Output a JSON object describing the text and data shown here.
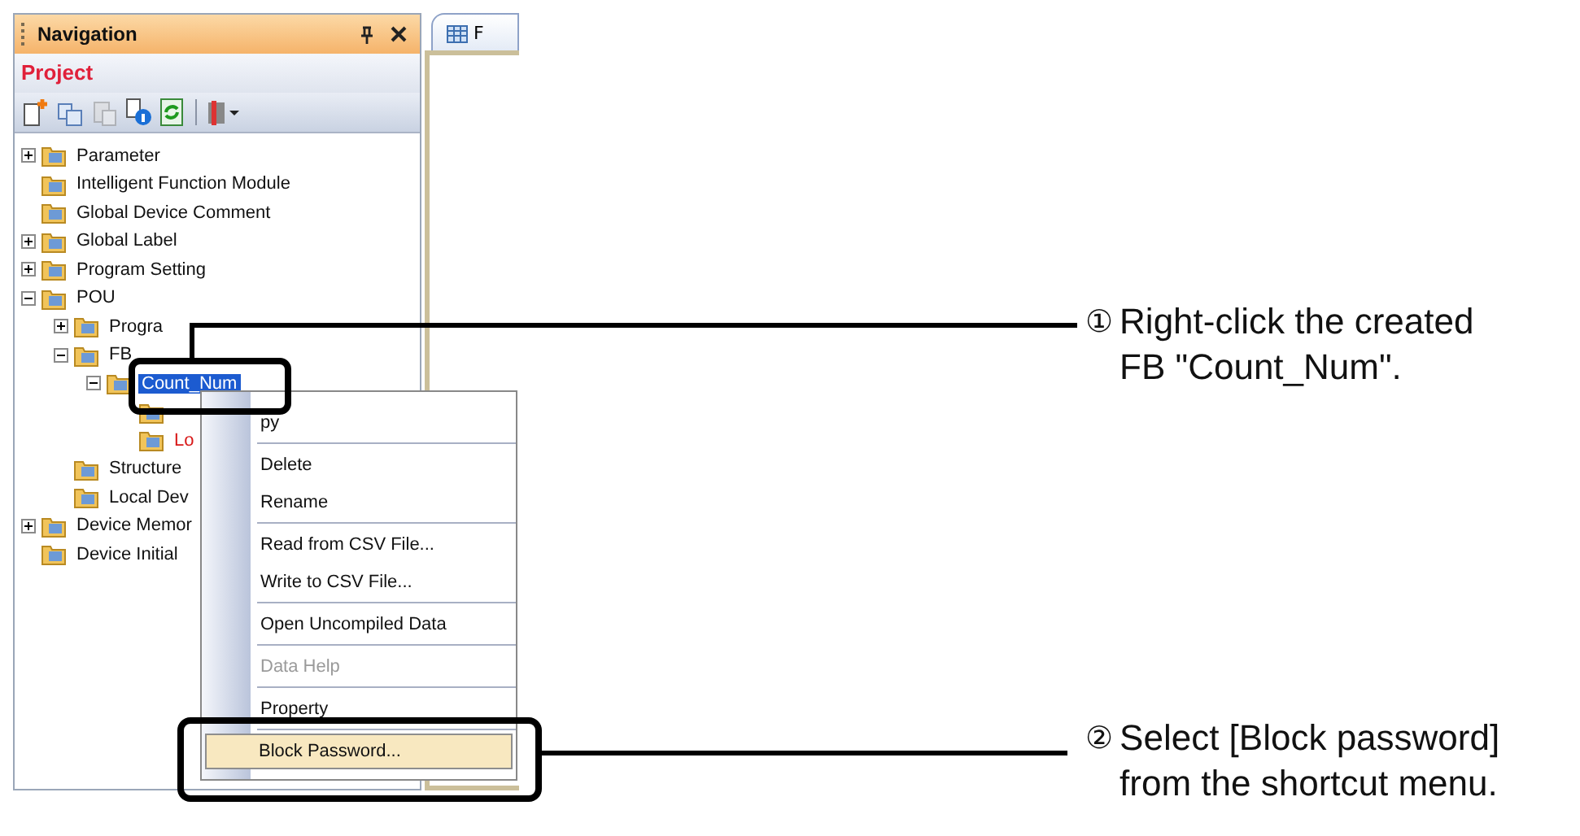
{
  "navigation": {
    "title": "Navigation",
    "section": "Project",
    "tree": [
      {
        "label": "Parameter",
        "expanded": false
      },
      {
        "label": "Intelligent Function Module"
      },
      {
        "label": "Global Device Comment"
      },
      {
        "label": "Global Label",
        "expanded": false
      },
      {
        "label": "Program Setting",
        "expanded": false
      },
      {
        "label": "POU",
        "expanded": true,
        "children": [
          {
            "label": "Progra",
            "expanded": false
          },
          {
            "label": "FB",
            "expanded": true,
            "children": [
              {
                "label": "Count_Num",
                "expanded": true,
                "selected": true,
                "children": [
                  {
                    "kind": "icon"
                  },
                  {
                    "kind": "text",
                    "label": "Lo",
                    "color": "#d81818",
                    "selected": false
                  }
                ]
              }
            ]
          },
          {
            "label": "Structure"
          },
          {
            "label": "Local Dev"
          }
        ]
      },
      {
        "label": "Device Memor",
        "expanded": false
      },
      {
        "label": "Device Initial"
      }
    ]
  },
  "editor": {
    "tab": "F"
  },
  "context_menu": [
    {
      "label": "py",
      "disabled": false,
      "selected": false,
      "separator_after": true
    },
    {
      "label": "Delete",
      "disabled": false,
      "selected": false,
      "separator_after": false
    },
    {
      "label": "Rename",
      "disabled": false,
      "selected": false,
      "separator_after": true
    },
    {
      "label": "Read from CSV File...",
      "disabled": false,
      "selected": false,
      "separator_after": false
    },
    {
      "label": "Write to CSV File...",
      "disabled": false,
      "selected": false,
      "separator_after": true
    },
    {
      "label": "Open Uncompiled Data",
      "disabled": false,
      "selected": false,
      "separator_after": true
    },
    {
      "label": "Data Help",
      "disabled": true,
      "selected": false,
      "separator_after": true
    },
    {
      "label": "Property",
      "disabled": false,
      "selected": false,
      "separator_after": true
    },
    {
      "label": "Block Password...",
      "disabled": false,
      "selected": true,
      "separator_after": false
    }
  ],
  "callouts": [
    {
      "number": "①",
      "lines": [
        "Right-click the created",
        "FB \"Count_Num\"."
      ]
    },
    {
      "number": "②",
      "lines": [
        "Select [Block password]",
        "from the shortcut menu."
      ]
    }
  ]
}
